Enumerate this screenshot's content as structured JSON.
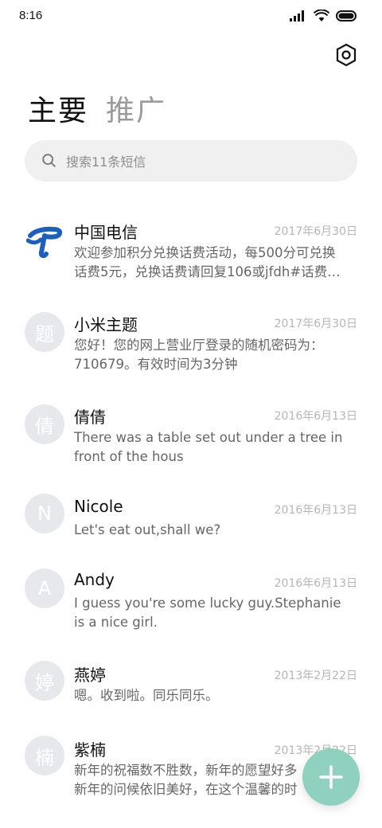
{
  "status_bar": {
    "time": "8:16",
    "icons": [
      "signal-icon",
      "wifi-icon",
      "battery-icon"
    ]
  },
  "header": {
    "tabs": [
      {
        "label": "主要",
        "active": true
      },
      {
        "label": "推广",
        "active": false
      }
    ],
    "settings_icon": "gear-icon"
  },
  "search": {
    "placeholder": "搜索11条短信",
    "icon": "search-icon"
  },
  "conversations": [
    {
      "name": "中国电信",
      "avatar": "",
      "date": "2017年6月30日",
      "preview_lines": [
        "欢迎参加积分兑换话费活动，每500分可兑换",
        "话费5元，兑换话费请回复106或jfdh#话费…"
      ]
    },
    {
      "name": "小米主题",
      "avatar": "题",
      "date": "2017年6月30日",
      "preview_lines": [
        "您好！您的网上营业厅登录的随机密码为：",
        "710679。有效时间为3分钟"
      ]
    },
    {
      "name": "倩倩",
      "avatar": "倩",
      "date": "2016年6月13日",
      "preview_lines": [
        "There was a table set out under a tree in",
        "front of the hous"
      ]
    },
    {
      "name": "Nicole",
      "avatar": "N",
      "date": "2016年6月13日",
      "preview_lines": [
        "Let's eat out,shall we?"
      ]
    },
    {
      "name": "Andy",
      "avatar": "A",
      "date": "2016年6月13日",
      "preview_lines": [
        "I guess you're some lucky guy.Stephanie",
        "is a nice girl."
      ]
    },
    {
      "name": "燕婷",
      "avatar": "婷",
      "date": "2013年2月22日",
      "preview_lines": [
        "嗯。收到啦。同乐同乐。"
      ]
    },
    {
      "name": "紫楠",
      "avatar": "楠",
      "date": "2013年2月22日",
      "preview_lines": [
        "新年的祝福数不胜数，新年的愿望好多",
        "新年的问候依旧美好，在这个温馨的时"
      ]
    }
  ],
  "fab": {
    "icon": "plus-icon",
    "color": "#8fd1be"
  },
  "colors": {
    "accent": "#8fd1be",
    "avatar_bg": "#e6e8ec",
    "secondary_text": "#9a9a9a"
  }
}
